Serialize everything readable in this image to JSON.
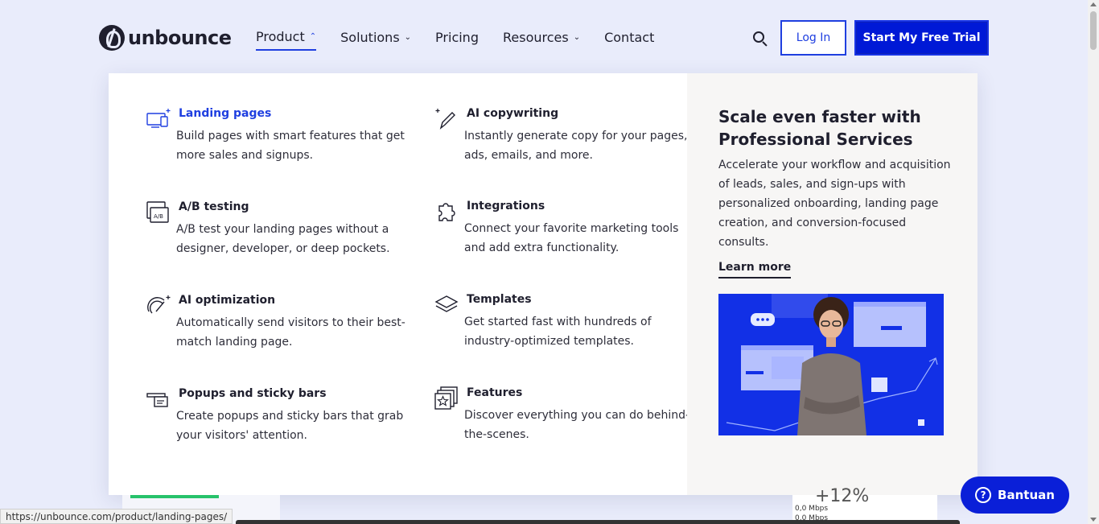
{
  "brand": {
    "name": "unbounce"
  },
  "nav": {
    "items": [
      {
        "label": "Product",
        "has_chevron": true,
        "active": true
      },
      {
        "label": "Solutions",
        "has_chevron": true
      },
      {
        "label": "Pricing",
        "has_chevron": false
      },
      {
        "label": "Resources",
        "has_chevron": true
      },
      {
        "label": "Contact",
        "has_chevron": false
      }
    ],
    "login_label": "Log In",
    "trial_label": "Start My Free Trial",
    "search_icon": "search-icon"
  },
  "dropdown": {
    "features": [
      {
        "title": "Landing pages",
        "desc": "Build pages with smart features that get more sales and signups.",
        "icon": "landing-pages-icon"
      },
      {
        "title": "AI copywriting",
        "desc": "Instantly generate copy for your pages, ads, emails, and more.",
        "icon": "ai-copywriting-icon"
      },
      {
        "title": "A/B testing",
        "desc": "A/B test your landing pages without a designer, developer, or deep pockets.",
        "icon": "ab-testing-icon"
      },
      {
        "title": "Integrations",
        "desc": "Connect your favorite marketing tools and add extra functionality.",
        "icon": "integrations-icon"
      },
      {
        "title": "AI optimization",
        "desc": "Automatically send visitors to their best-match landing page.",
        "icon": "ai-optimization-icon"
      },
      {
        "title": "Templates",
        "desc": "Get started fast with hundreds of industry-optimized templates.",
        "icon": "templates-icon"
      },
      {
        "title": "Popups and sticky bars",
        "desc": "Create popups and sticky bars that grab your visitors' attention.",
        "icon": "popups-icon"
      },
      {
        "title": "Features",
        "desc": "Discover everything you can do behind-the-scenes.",
        "icon": "features-icon"
      }
    ],
    "promo": {
      "title": "Scale even faster with Professional Services",
      "desc": "Accelerate your workflow and acquisition of leads, sales, and sign-ups with personalized onboarding, landing page creation, and conversion-focused consults.",
      "link": "Learn more"
    }
  },
  "background": {
    "metric": "+12%",
    "network": "0,0 Mbps"
  },
  "status_url": "https://unbounce.com/product/landing-pages/",
  "help": {
    "label": "Bantuan"
  },
  "colors": {
    "accent": "#1f3fe0",
    "trial_bg": "#0019d6",
    "page_bg": "#e9ecfb"
  }
}
